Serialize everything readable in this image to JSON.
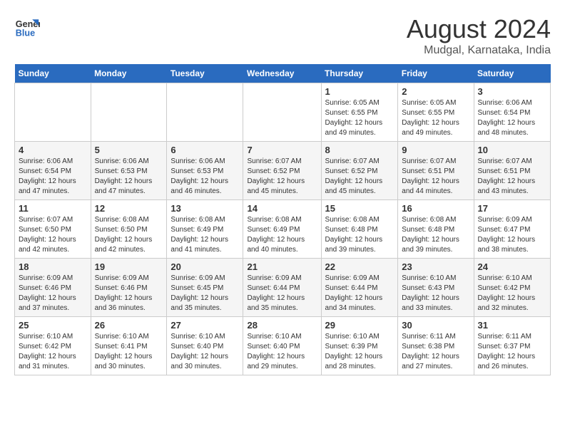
{
  "header": {
    "logo_line1": "General",
    "logo_line2": "Blue",
    "main_title": "August 2024",
    "sub_title": "Mudgal, Karnataka, India"
  },
  "calendar": {
    "days_of_week": [
      "Sunday",
      "Monday",
      "Tuesday",
      "Wednesday",
      "Thursday",
      "Friday",
      "Saturday"
    ],
    "weeks": [
      [
        {
          "day": "",
          "info": ""
        },
        {
          "day": "",
          "info": ""
        },
        {
          "day": "",
          "info": ""
        },
        {
          "day": "",
          "info": ""
        },
        {
          "day": "1",
          "info": "Sunrise: 6:05 AM\nSunset: 6:55 PM\nDaylight: 12 hours\nand 49 minutes."
        },
        {
          "day": "2",
          "info": "Sunrise: 6:05 AM\nSunset: 6:55 PM\nDaylight: 12 hours\nand 49 minutes."
        },
        {
          "day": "3",
          "info": "Sunrise: 6:06 AM\nSunset: 6:54 PM\nDaylight: 12 hours\nand 48 minutes."
        }
      ],
      [
        {
          "day": "4",
          "info": "Sunrise: 6:06 AM\nSunset: 6:54 PM\nDaylight: 12 hours\nand 47 minutes."
        },
        {
          "day": "5",
          "info": "Sunrise: 6:06 AM\nSunset: 6:53 PM\nDaylight: 12 hours\nand 47 minutes."
        },
        {
          "day": "6",
          "info": "Sunrise: 6:06 AM\nSunset: 6:53 PM\nDaylight: 12 hours\nand 46 minutes."
        },
        {
          "day": "7",
          "info": "Sunrise: 6:07 AM\nSunset: 6:52 PM\nDaylight: 12 hours\nand 45 minutes."
        },
        {
          "day": "8",
          "info": "Sunrise: 6:07 AM\nSunset: 6:52 PM\nDaylight: 12 hours\nand 45 minutes."
        },
        {
          "day": "9",
          "info": "Sunrise: 6:07 AM\nSunset: 6:51 PM\nDaylight: 12 hours\nand 44 minutes."
        },
        {
          "day": "10",
          "info": "Sunrise: 6:07 AM\nSunset: 6:51 PM\nDaylight: 12 hours\nand 43 minutes."
        }
      ],
      [
        {
          "day": "11",
          "info": "Sunrise: 6:07 AM\nSunset: 6:50 PM\nDaylight: 12 hours\nand 42 minutes."
        },
        {
          "day": "12",
          "info": "Sunrise: 6:08 AM\nSunset: 6:50 PM\nDaylight: 12 hours\nand 42 minutes."
        },
        {
          "day": "13",
          "info": "Sunrise: 6:08 AM\nSunset: 6:49 PM\nDaylight: 12 hours\nand 41 minutes."
        },
        {
          "day": "14",
          "info": "Sunrise: 6:08 AM\nSunset: 6:49 PM\nDaylight: 12 hours\nand 40 minutes."
        },
        {
          "day": "15",
          "info": "Sunrise: 6:08 AM\nSunset: 6:48 PM\nDaylight: 12 hours\nand 39 minutes."
        },
        {
          "day": "16",
          "info": "Sunrise: 6:08 AM\nSunset: 6:48 PM\nDaylight: 12 hours\nand 39 minutes."
        },
        {
          "day": "17",
          "info": "Sunrise: 6:09 AM\nSunset: 6:47 PM\nDaylight: 12 hours\nand 38 minutes."
        }
      ],
      [
        {
          "day": "18",
          "info": "Sunrise: 6:09 AM\nSunset: 6:46 PM\nDaylight: 12 hours\nand 37 minutes."
        },
        {
          "day": "19",
          "info": "Sunrise: 6:09 AM\nSunset: 6:46 PM\nDaylight: 12 hours\nand 36 minutes."
        },
        {
          "day": "20",
          "info": "Sunrise: 6:09 AM\nSunset: 6:45 PM\nDaylight: 12 hours\nand 35 minutes."
        },
        {
          "day": "21",
          "info": "Sunrise: 6:09 AM\nSunset: 6:44 PM\nDaylight: 12 hours\nand 35 minutes."
        },
        {
          "day": "22",
          "info": "Sunrise: 6:09 AM\nSunset: 6:44 PM\nDaylight: 12 hours\nand 34 minutes."
        },
        {
          "day": "23",
          "info": "Sunrise: 6:10 AM\nSunset: 6:43 PM\nDaylight: 12 hours\nand 33 minutes."
        },
        {
          "day": "24",
          "info": "Sunrise: 6:10 AM\nSunset: 6:42 PM\nDaylight: 12 hours\nand 32 minutes."
        }
      ],
      [
        {
          "day": "25",
          "info": "Sunrise: 6:10 AM\nSunset: 6:42 PM\nDaylight: 12 hours\nand 31 minutes."
        },
        {
          "day": "26",
          "info": "Sunrise: 6:10 AM\nSunset: 6:41 PM\nDaylight: 12 hours\nand 30 minutes."
        },
        {
          "day": "27",
          "info": "Sunrise: 6:10 AM\nSunset: 6:40 PM\nDaylight: 12 hours\nand 30 minutes."
        },
        {
          "day": "28",
          "info": "Sunrise: 6:10 AM\nSunset: 6:40 PM\nDaylight: 12 hours\nand 29 minutes."
        },
        {
          "day": "29",
          "info": "Sunrise: 6:10 AM\nSunset: 6:39 PM\nDaylight: 12 hours\nand 28 minutes."
        },
        {
          "day": "30",
          "info": "Sunrise: 6:11 AM\nSunset: 6:38 PM\nDaylight: 12 hours\nand 27 minutes."
        },
        {
          "day": "31",
          "info": "Sunrise: 6:11 AM\nSunset: 6:37 PM\nDaylight: 12 hours\nand 26 minutes."
        }
      ]
    ]
  }
}
